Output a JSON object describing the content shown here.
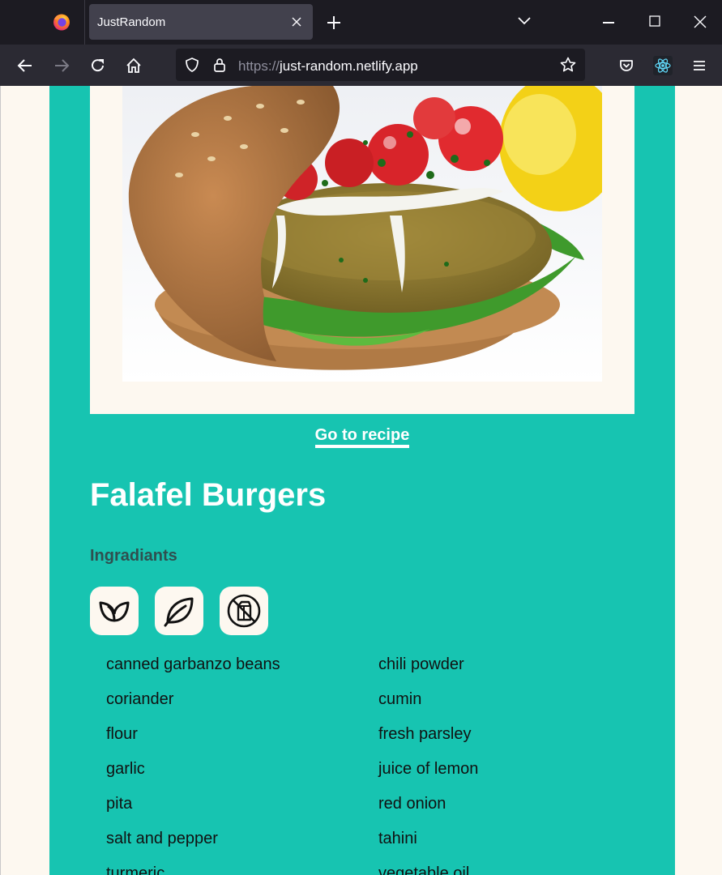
{
  "browser": {
    "tab_title": "JustRandom",
    "url_protocol": "https://",
    "url_host": "just-random.netlify.app"
  },
  "recipe": {
    "link_label": "Go to recipe",
    "title": "Falafel Burgers",
    "ingredients_heading": "Ingradiants",
    "diet_badges": [
      "vegan-icon",
      "vegetarian-leaf-icon",
      "dairy-free-icon"
    ],
    "ingredients": [
      "canned garbanzo beans",
      "chili powder",
      "coriander",
      "cumin",
      "flour",
      "fresh parsley",
      "garlic",
      "juice of lemon",
      "pita",
      "red onion",
      "salt and pepper",
      "tahini",
      "turmeric",
      "vegetable oil"
    ]
  },
  "colors": {
    "card_teal": "#17c4b1",
    "page_cream": "#fdf8f0",
    "heading_dark": "#2f4f4f"
  }
}
